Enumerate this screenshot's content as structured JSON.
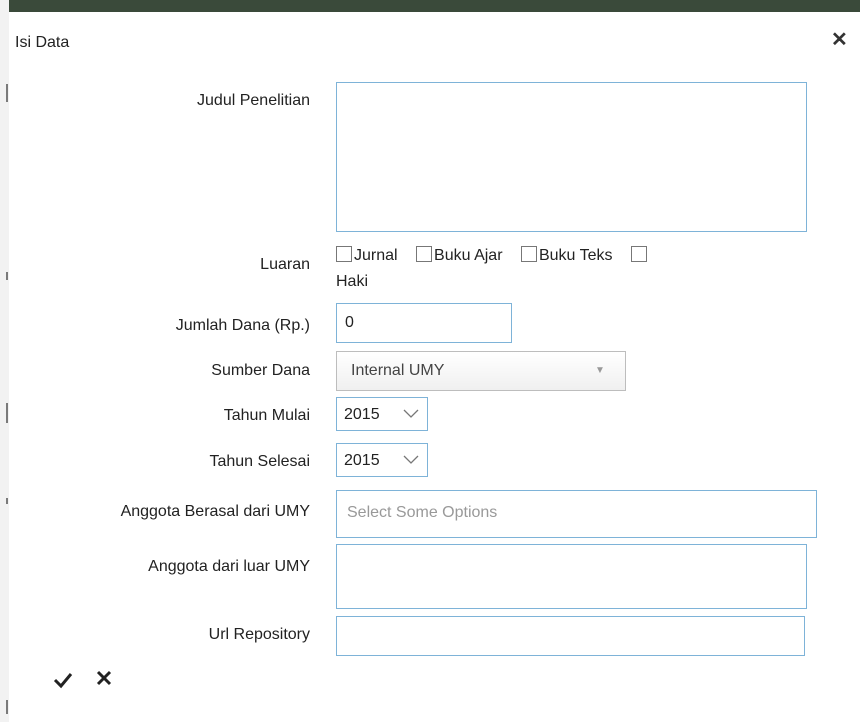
{
  "dialog": {
    "title": "Isi Data"
  },
  "form": {
    "judul_label": "Judul Penelitian",
    "judul_value": "",
    "luaran_label": "Luaran",
    "luaran_options": [
      {
        "label": "Jurnal",
        "checked": false
      },
      {
        "label": "Buku Ajar",
        "checked": false
      },
      {
        "label": "Buku Teks",
        "checked": false
      },
      {
        "label": "Haki",
        "checked": false
      }
    ],
    "jumlah_label": "Jumlah Dana (Rp.)",
    "jumlah_value": "0",
    "sumber_label": "Sumber Dana",
    "sumber_value": "Internal UMY",
    "tahun_mulai_label": "Tahun Mulai",
    "tahun_mulai_value": "2015",
    "tahun_selesai_label": "Tahun Selesai",
    "tahun_selesai_value": "2015",
    "anggota_umy_label": "Anggota Berasal dari UMY",
    "anggota_umy_placeholder": "Select Some Options",
    "anggota_luar_label": "Anggota dari luar UMY",
    "anggota_luar_value": "",
    "url_label": "Url Repository",
    "url_value": ""
  },
  "icons": {
    "close": "close-icon",
    "save": "checkmark-icon",
    "cancel": "close-icon"
  }
}
